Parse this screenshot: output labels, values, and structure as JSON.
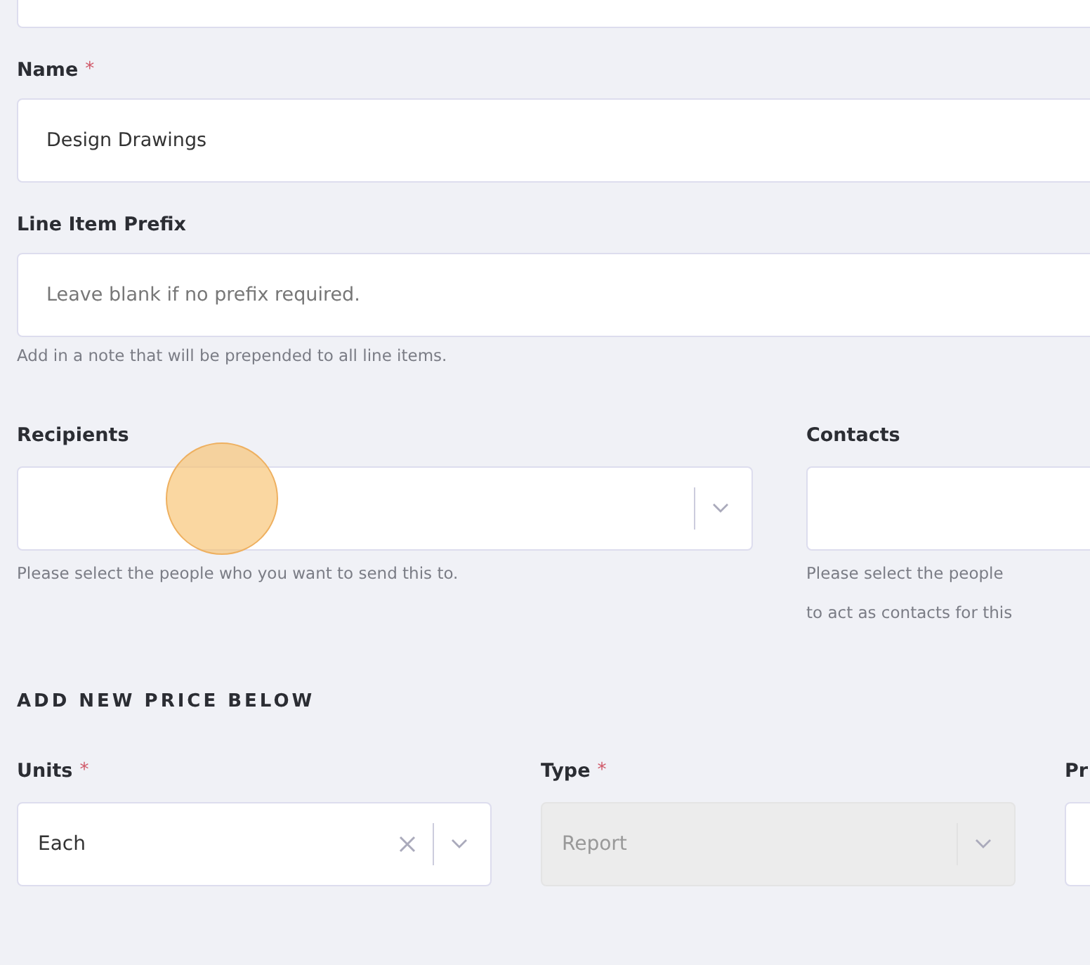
{
  "fields": [
    {
      "label": "Name",
      "required_mark": "*",
      "kind": "text",
      "value": "Design Drawings"
    },
    {
      "label": "Line Item Prefix",
      "kind": "text",
      "placeholder": "Leave blank if no prefix required.",
      "help": "Add in a note that will be prepended to all line items."
    }
  ],
  "pickers": [
    {
      "label": "Recipients",
      "help": [
        "Please select the people who you want to send this to."
      ]
    },
    {
      "label": "Contacts",
      "help": [
        "Please select the people",
        "to act as contacts for this"
      ]
    }
  ],
  "price_section": {
    "heading": "ADD NEW PRICE BELOW",
    "fields": [
      {
        "label": "Units",
        "required_mark": "*",
        "value": "Each",
        "clearable": true,
        "disabled": false
      },
      {
        "label": "Type",
        "required_mark": "*",
        "value": "Report",
        "clearable": false,
        "disabled": true
      },
      {
        "label": "Pr"
      }
    ]
  }
}
